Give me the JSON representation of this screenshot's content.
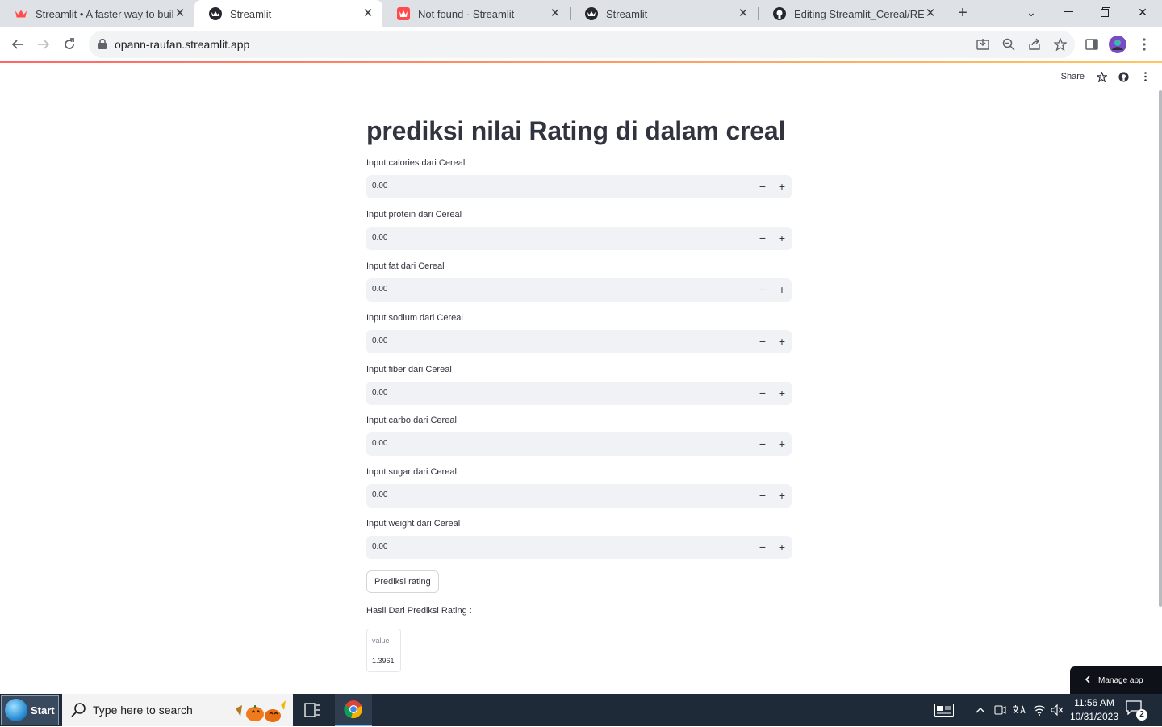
{
  "browser": {
    "tabs": [
      {
        "title": "Streamlit • A faster way to build"
      },
      {
        "title": "Streamlit"
      },
      {
        "title": "Not found · Streamlit"
      },
      {
        "title": "Streamlit"
      },
      {
        "title": "Editing Streamlit_Cereal/READM"
      }
    ],
    "active_tab_index": 1,
    "url": "opann-raufan.streamlit.app"
  },
  "app_toolbar": {
    "share_label": "Share"
  },
  "app": {
    "title": "prediksi nilai Rating di dalam creal",
    "fields": [
      {
        "label": "Input calories dari Cereal",
        "value": "0.00"
      },
      {
        "label": "Input protein dari Cereal",
        "value": "0.00"
      },
      {
        "label": "Input fat dari Cereal",
        "value": "0.00"
      },
      {
        "label": "Input sodium dari Cereal",
        "value": "0.00"
      },
      {
        "label": "Input fiber dari Cereal",
        "value": "0.00"
      },
      {
        "label": "Input carbo dari Cereal",
        "value": "0.00"
      },
      {
        "label": "Input sugar dari Cereal",
        "value": "0.00"
      },
      {
        "label": "Input weight dari Cereal",
        "value": "0.00"
      }
    ],
    "stepper_minus": "−",
    "stepper_plus": "+",
    "predict_button": "Prediksi rating",
    "result_label": "Hasil Dari Prediksi Rating :",
    "result_table": {
      "header": "value",
      "value": "1.3961"
    },
    "manage_app": "Manage app"
  },
  "taskbar": {
    "start_label": "Start",
    "search_placeholder": "Type here to search",
    "time": "11:56 AM",
    "date": "10/31/2023",
    "notification_count": "2"
  },
  "colors": {
    "streamlit_red": "#ff4b4b",
    "input_bg": "#f0f2f6",
    "text": "#31333f",
    "taskbar_bg": "#1f2a38"
  }
}
